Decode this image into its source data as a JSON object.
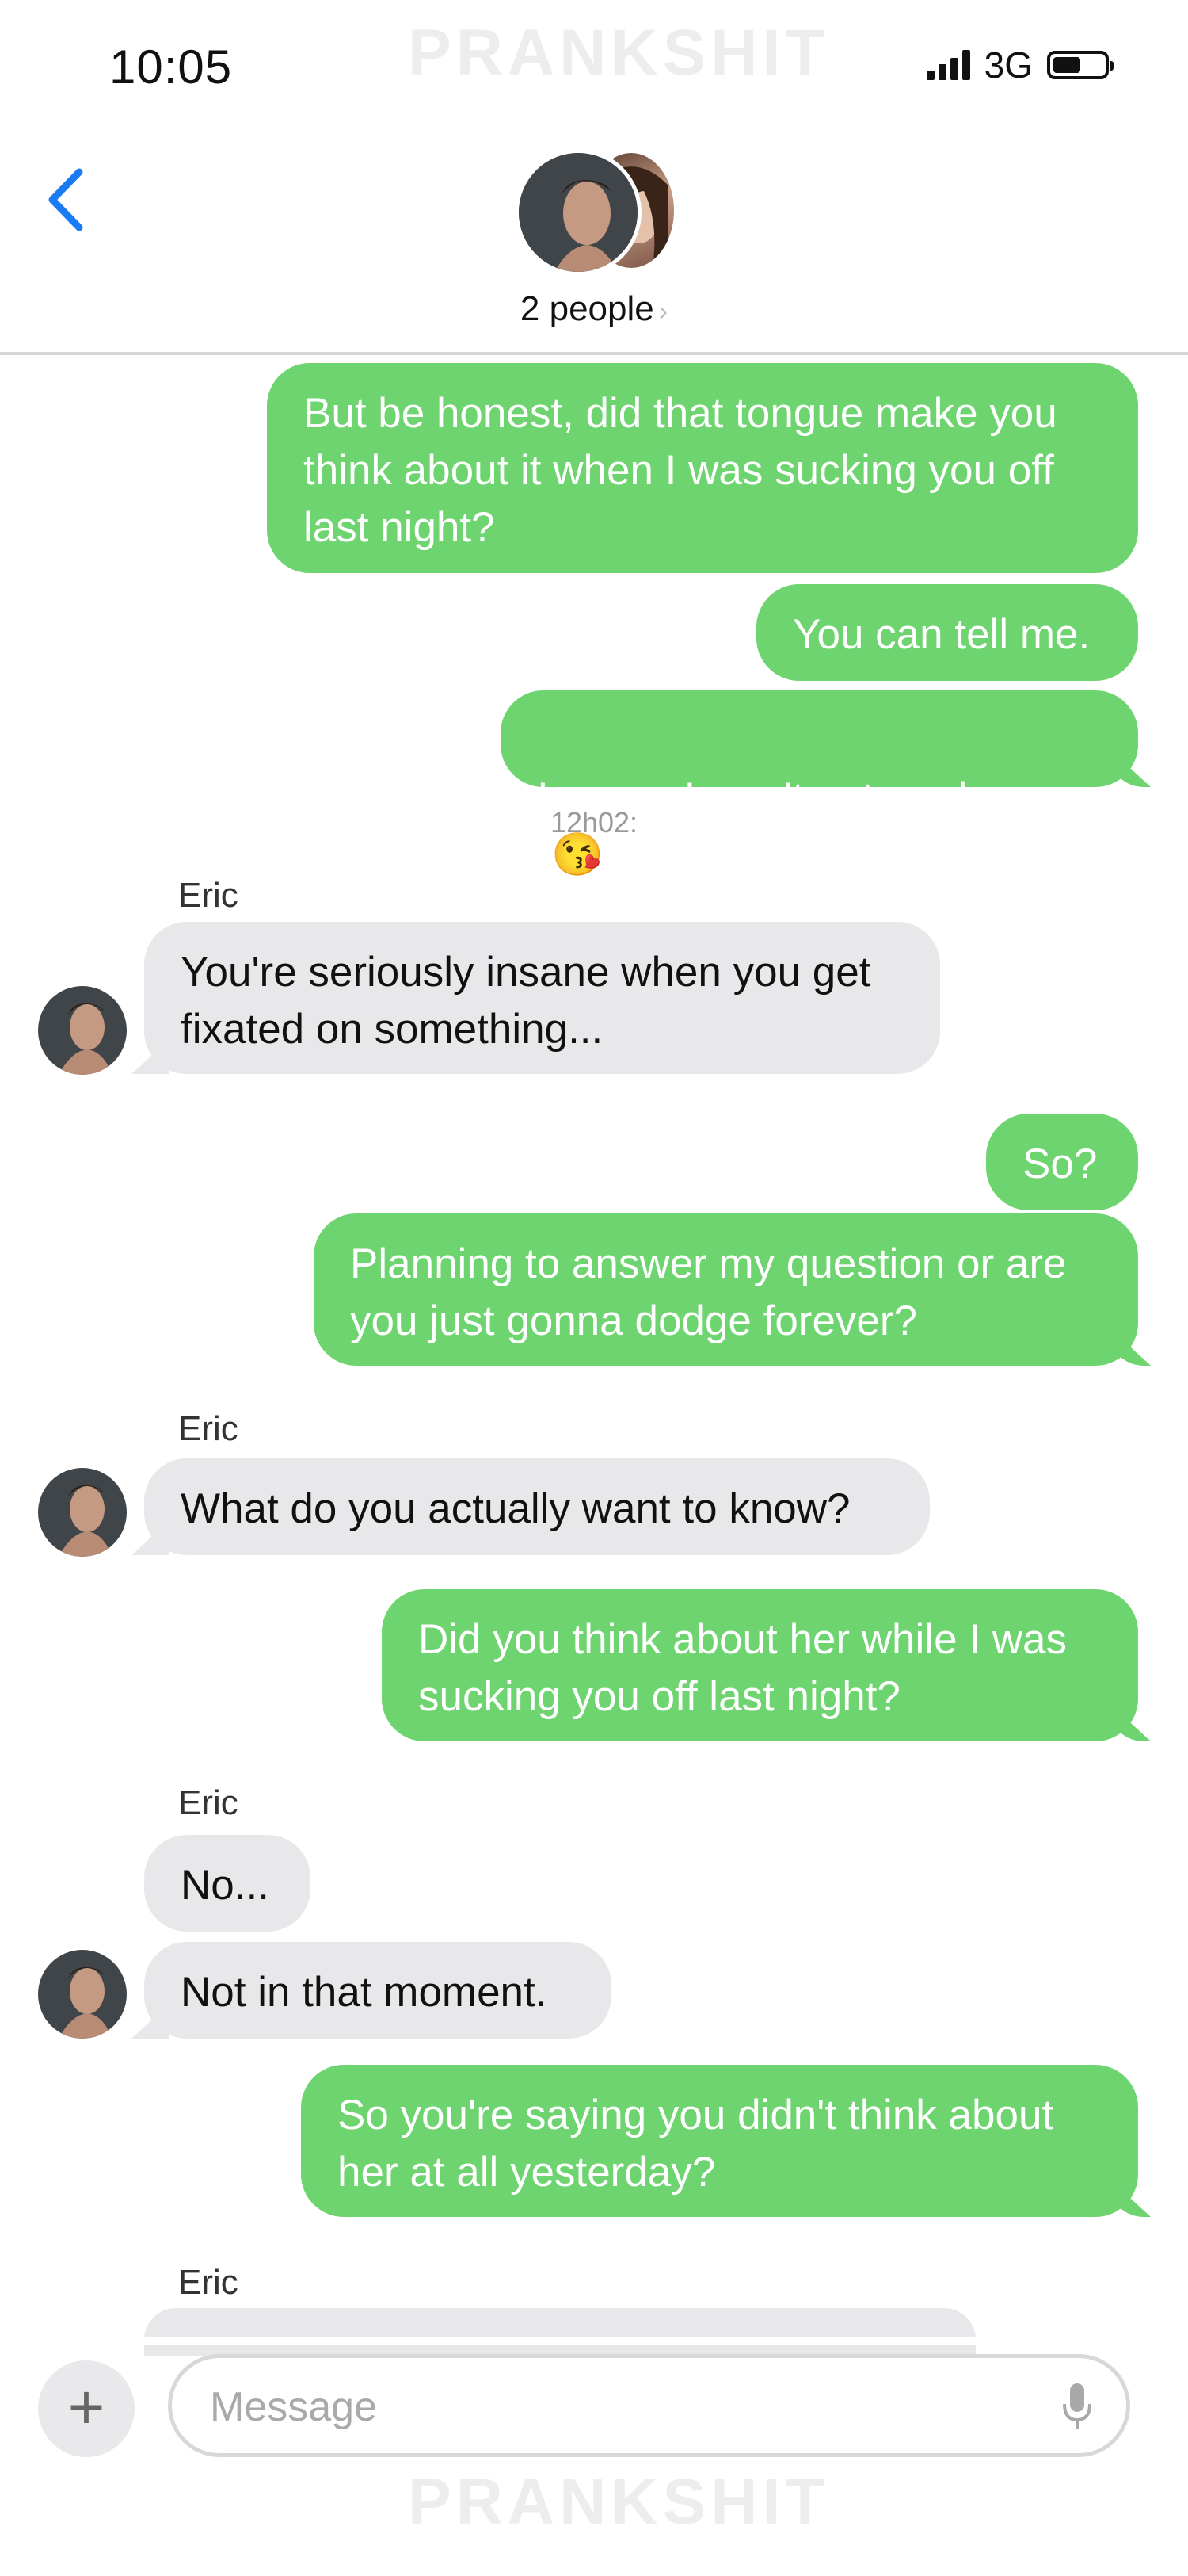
{
  "status_bar": {
    "time": "10:05",
    "network": "3G"
  },
  "watermark": "PRANKSHIT",
  "header": {
    "title": "2 people",
    "chevron": "›",
    "back_icon": "chevron-left-icon"
  },
  "colors": {
    "sent_bubble": "#6ed46f",
    "received_bubble": "#e8e8eb",
    "accent": "#1a7cf5"
  },
  "messages": [
    {
      "from": "me",
      "text": "But be honest, did that tongue make you\nthink about it when I was sucking you off\nlast night?"
    },
    {
      "from": "me",
      "text": "You can tell me."
    },
    {
      "from": "me",
      "text": "I swear I won't get mad...",
      "emoji": "😘"
    },
    {
      "type": "timestamp",
      "text": "12h02:"
    },
    {
      "from": "Eric",
      "sender_label": "Eric",
      "text": "You're seriously insane when you get\nfixated on something..."
    },
    {
      "from": "me",
      "text": "So?"
    },
    {
      "from": "me",
      "text": "Planning to answer my question or are\nyou just gonna dodge forever?"
    },
    {
      "from": "Eric",
      "sender_label": "Eric",
      "text": "What do you actually want to know?"
    },
    {
      "from": "me",
      "text": "Did you think about her while I was\nsucking you off last night?"
    },
    {
      "from": "Eric",
      "sender_label": "Eric",
      "text": "No..."
    },
    {
      "from": "Eric",
      "text": "Not in that moment."
    },
    {
      "from": "me",
      "text": "So you're saying you didn't think about\nher at all yesterday?"
    },
    {
      "from": "Eric",
      "sender_label": "Eric",
      "text": ""
    }
  ],
  "composer": {
    "placeholder": "Message",
    "plus": "+"
  }
}
